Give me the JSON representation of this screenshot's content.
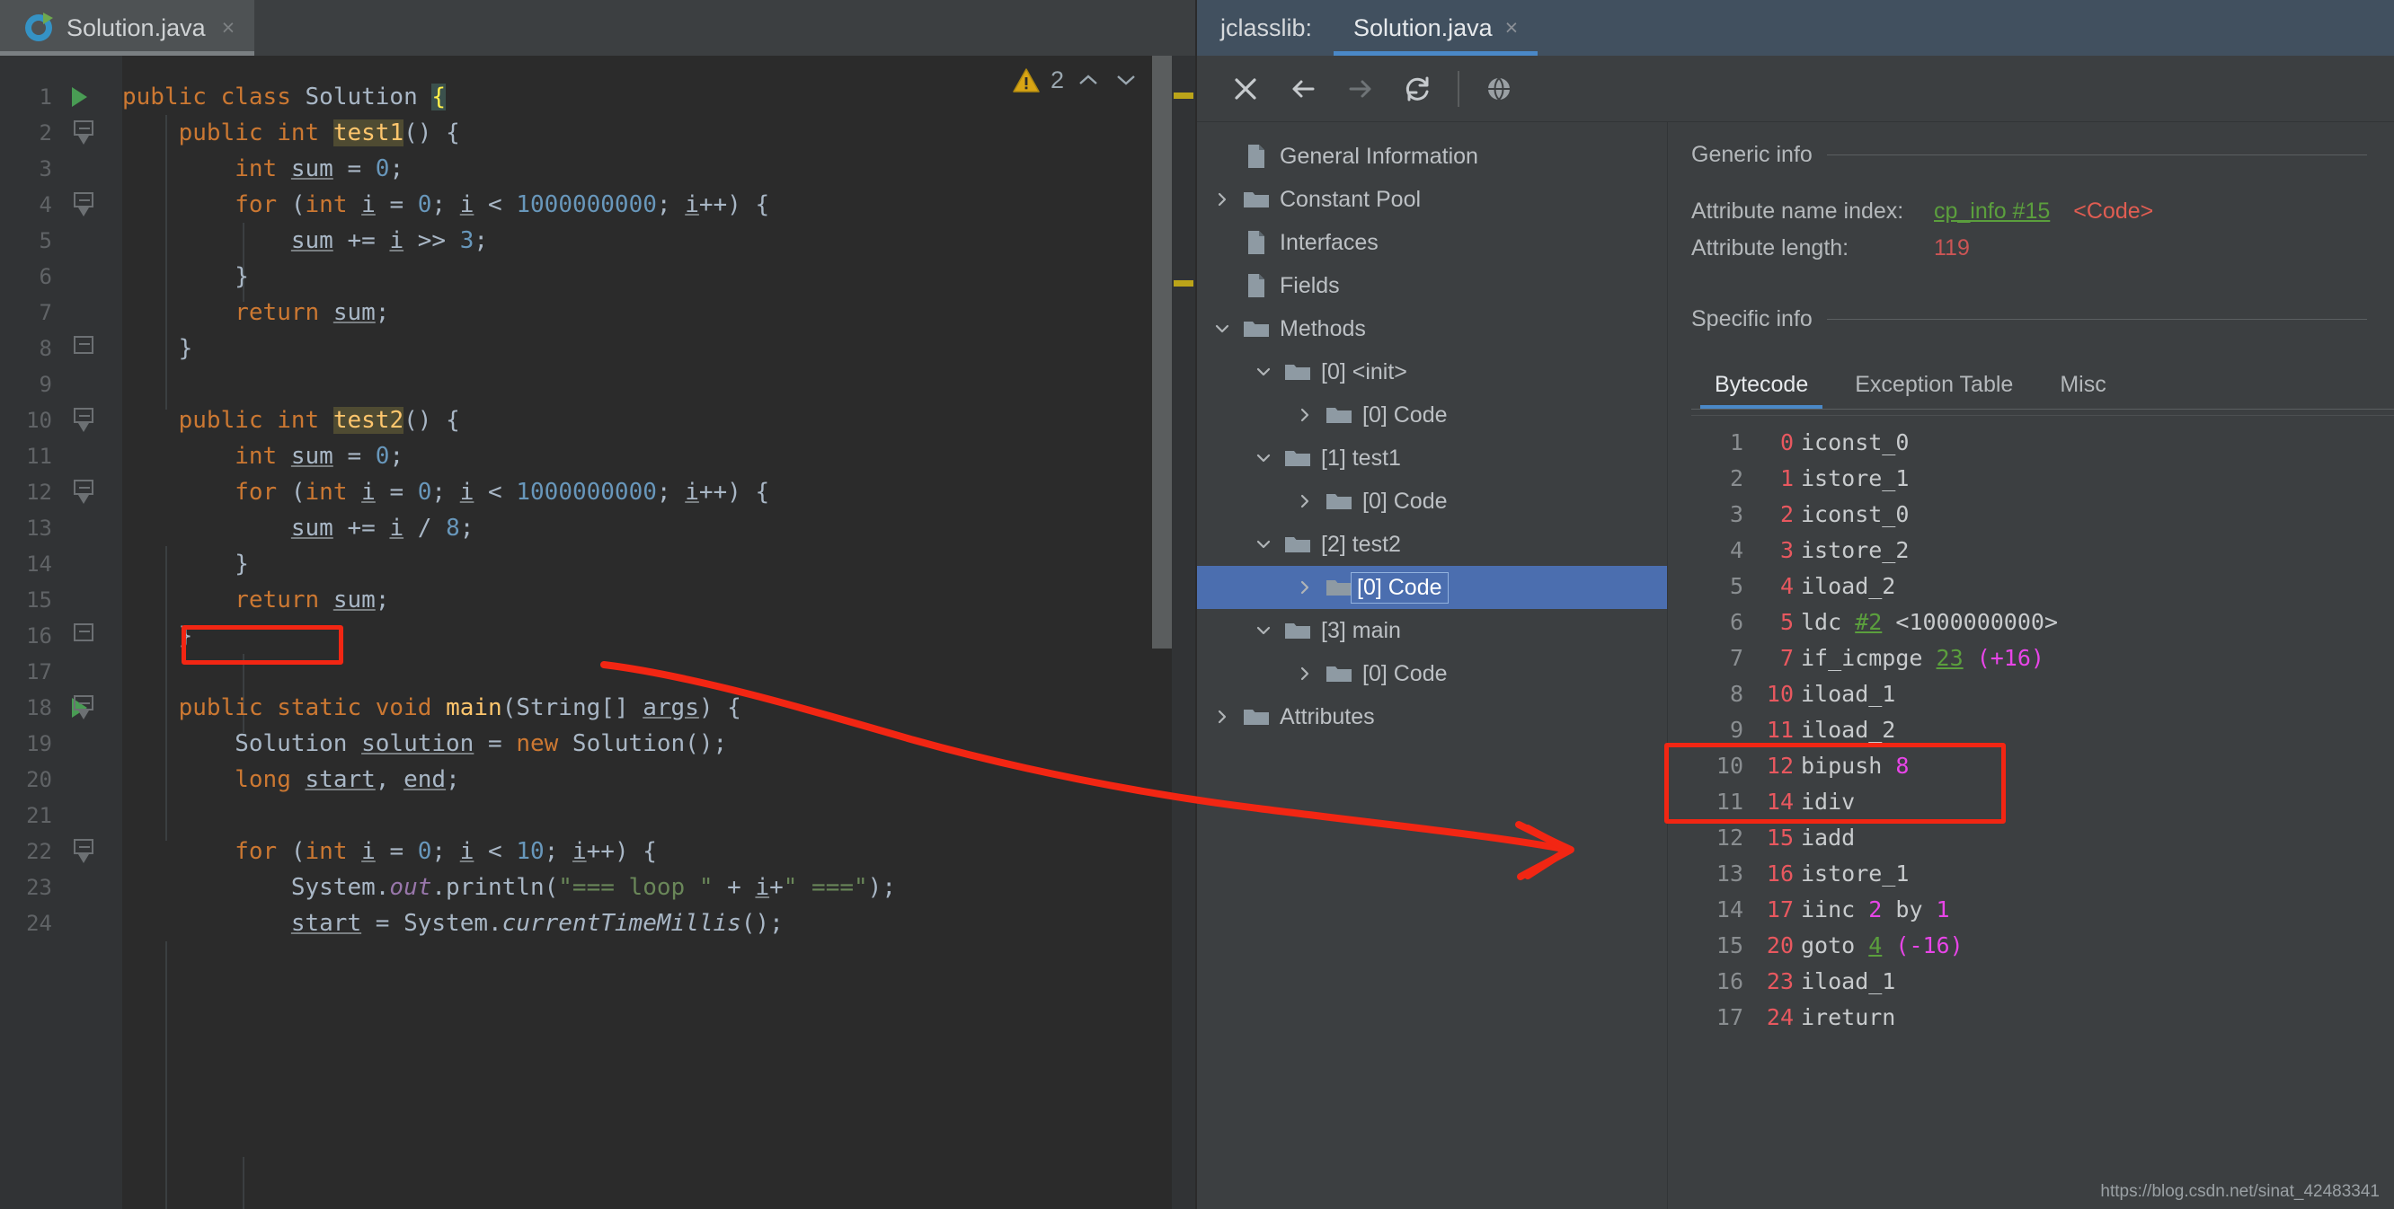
{
  "editor": {
    "tab": {
      "label": "Solution.java",
      "close": "×",
      "icon": "java-class-icon"
    },
    "inspection": {
      "warning_count": "2",
      "up": "⌃",
      "down": "⌄"
    },
    "lines": [
      {
        "n": "1",
        "mark": "run",
        "fold": "",
        "text": "public class Solution {"
      },
      {
        "n": "2",
        "mark": "",
        "fold": "start",
        "text": "    public int test1() {"
      },
      {
        "n": "3",
        "mark": "",
        "fold": "",
        "text": "        int sum = 0;"
      },
      {
        "n": "4",
        "mark": "",
        "fold": "start",
        "text": "        for (int i = 0; i < 1000000000; i++) {"
      },
      {
        "n": "5",
        "mark": "",
        "fold": "",
        "text": "            sum += i >> 3;"
      },
      {
        "n": "6",
        "mark": "",
        "fold": "",
        "text": "        }"
      },
      {
        "n": "7",
        "mark": "",
        "fold": "",
        "text": "        return sum;"
      },
      {
        "n": "8",
        "mark": "",
        "fold": "end",
        "text": "    }"
      },
      {
        "n": "9",
        "mark": "",
        "fold": "",
        "text": ""
      },
      {
        "n": "10",
        "mark": "",
        "fold": "start",
        "text": "    public int test2() {"
      },
      {
        "n": "11",
        "mark": "",
        "fold": "",
        "text": "        int sum = 0;"
      },
      {
        "n": "12",
        "mark": "",
        "fold": "start",
        "text": "        for (int i = 0; i < 1000000000; i++) {"
      },
      {
        "n": "13",
        "mark": "",
        "fold": "",
        "text": "            sum += i / 8;"
      },
      {
        "n": "14",
        "mark": "",
        "fold": "",
        "text": "        }"
      },
      {
        "n": "15",
        "mark": "",
        "fold": "",
        "text": "        return sum;"
      },
      {
        "n": "16",
        "mark": "",
        "fold": "end",
        "text": "    }"
      },
      {
        "n": "17",
        "mark": "",
        "fold": "",
        "text": ""
      },
      {
        "n": "18",
        "mark": "run",
        "fold": "start",
        "text": "    public static void main(String[] args) {"
      },
      {
        "n": "19",
        "mark": "",
        "fold": "",
        "text": "        Solution solution = new Solution();"
      },
      {
        "n": "20",
        "mark": "",
        "fold": "",
        "text": "        long start, end;"
      },
      {
        "n": "21",
        "mark": "",
        "fold": "",
        "text": ""
      },
      {
        "n": "22",
        "mark": "",
        "fold": "start",
        "text": "        for (int i = 0; i < 10; i++) {"
      },
      {
        "n": "23",
        "mark": "",
        "fold": "",
        "text": "            System.out.println(\"=== loop \" + i+\" ===\");"
      },
      {
        "n": "24",
        "mark": "",
        "fold": "",
        "text": "            start = System.currentTimeMillis();"
      }
    ]
  },
  "annotations": {
    "code_box_label": "sum += i / 8;",
    "bytecode_box_label": "12 bipush 8 / 14 idiv",
    "arrow_color": "#f22613"
  },
  "tool": {
    "title": "jclasslib:",
    "tab": {
      "label": "Solution.java",
      "close": "×"
    },
    "toolbar": [
      {
        "name": "close-icon",
        "label": "Close"
      },
      {
        "name": "back-icon",
        "label": "Back"
      },
      {
        "name": "forward-icon",
        "label": "Forward"
      },
      {
        "name": "reload-icon",
        "label": "Reload"
      },
      {
        "name": "browse-icon",
        "label": "Browse"
      }
    ],
    "tree": [
      {
        "label": "General Information",
        "indent": 1,
        "twist": "none",
        "icon": "file-icon",
        "selected": false
      },
      {
        "label": "Constant Pool",
        "indent": 1,
        "twist": "right",
        "icon": "folder-icon",
        "selected": false
      },
      {
        "label": "Interfaces",
        "indent": 1,
        "twist": "none",
        "icon": "file-icon",
        "selected": false
      },
      {
        "label": "Fields",
        "indent": 1,
        "twist": "none",
        "icon": "file-icon",
        "selected": false
      },
      {
        "label": "Methods",
        "indent": 1,
        "twist": "down",
        "icon": "folder-icon",
        "selected": false
      },
      {
        "label": "[0] <init>",
        "indent": 2,
        "twist": "down",
        "icon": "folder-icon",
        "selected": false
      },
      {
        "label": "[0] Code",
        "indent": 3,
        "twist": "right",
        "icon": "folder-icon",
        "selected": false
      },
      {
        "label": "[1] test1",
        "indent": 2,
        "twist": "down",
        "icon": "folder-icon",
        "selected": false
      },
      {
        "label": "[0] Code",
        "indent": 3,
        "twist": "right",
        "icon": "folder-icon",
        "selected": false
      },
      {
        "label": "[2] test2",
        "indent": 2,
        "twist": "down",
        "icon": "folder-icon",
        "selected": false
      },
      {
        "label": "[0] Code",
        "indent": 3,
        "twist": "right",
        "icon": "folder-icon",
        "selected": true
      },
      {
        "label": "[3] main",
        "indent": 2,
        "twist": "down",
        "icon": "folder-icon",
        "selected": false
      },
      {
        "label": "[0] Code",
        "indent": 3,
        "twist": "right",
        "icon": "folder-icon",
        "selected": false
      },
      {
        "label": "Attributes",
        "indent": 1,
        "twist": "right",
        "icon": "folder-icon",
        "selected": false
      }
    ],
    "generic_info": {
      "heading": "Generic info",
      "attribute_name_index_label": "Attribute name index:",
      "attribute_name_index_link": "cp_info #15",
      "attribute_name_index_value": "<Code>",
      "attribute_length_label": "Attribute length:",
      "attribute_length_value": "119"
    },
    "specific_info": {
      "heading": "Specific info",
      "tabs": [
        {
          "label": "Bytecode",
          "active": true
        },
        {
          "label": "Exception Table",
          "active": false
        },
        {
          "label": "Misc",
          "active": false
        }
      ]
    },
    "bytecode": [
      {
        "ln": "1",
        "offset": "0",
        "mnemonic": "iconst_0",
        "operand": "",
        "extra": "",
        "highlight": false
      },
      {
        "ln": "2",
        "offset": "1",
        "mnemonic": "istore_1",
        "operand": "",
        "extra": "",
        "highlight": false
      },
      {
        "ln": "3",
        "offset": "2",
        "mnemonic": "iconst_0",
        "operand": "",
        "extra": "",
        "highlight": false
      },
      {
        "ln": "4",
        "offset": "3",
        "mnemonic": "istore_2",
        "operand": "",
        "extra": "",
        "highlight": false
      },
      {
        "ln": "5",
        "offset": "4",
        "mnemonic": "iload_2",
        "operand": "",
        "extra": "",
        "highlight": false
      },
      {
        "ln": "6",
        "offset": "5",
        "mnemonic": "ldc",
        "operand": "#2",
        "extra": "<1000000000>",
        "highlight": false
      },
      {
        "ln": "7",
        "offset": "7",
        "mnemonic": "if_icmpge",
        "operand": "23",
        "extra": "(+16)",
        "highlight": false
      },
      {
        "ln": "8",
        "offset": "10",
        "mnemonic": "iload_1",
        "operand": "",
        "extra": "",
        "highlight": false
      },
      {
        "ln": "9",
        "offset": "11",
        "mnemonic": "iload_2",
        "operand": "",
        "extra": "",
        "highlight": false
      },
      {
        "ln": "10",
        "offset": "12",
        "mnemonic": "bipush",
        "operand": "8",
        "extra": "",
        "highlight": true
      },
      {
        "ln": "11",
        "offset": "14",
        "mnemonic": "idiv",
        "operand": "",
        "extra": "",
        "highlight": true
      },
      {
        "ln": "12",
        "offset": "15",
        "mnemonic": "iadd",
        "operand": "",
        "extra": "",
        "highlight": false
      },
      {
        "ln": "13",
        "offset": "16",
        "mnemonic": "istore_1",
        "operand": "",
        "extra": "",
        "highlight": false
      },
      {
        "ln": "14",
        "offset": "17",
        "mnemonic": "iinc",
        "operand": "2",
        "extra": "by 1",
        "highlight": false
      },
      {
        "ln": "15",
        "offset": "20",
        "mnemonic": "goto",
        "operand": "4",
        "extra": "(-16)",
        "highlight": false
      },
      {
        "ln": "16",
        "offset": "23",
        "mnemonic": "iload_1",
        "operand": "",
        "extra": "",
        "highlight": false
      },
      {
        "ln": "17",
        "offset": "24",
        "mnemonic": "ireturn",
        "operand": "",
        "extra": "",
        "highlight": false
      }
    ]
  },
  "watermark": "https://blog.csdn.net/sinat_42483341",
  "colors": {
    "accent_blue": "#4a88c7",
    "selection_blue": "#4b6eaf",
    "annotation_red": "#f22613",
    "warning_yellow": "#bba419",
    "keyword_orange": "#cc7832",
    "number_blue": "#6897bb",
    "string_green": "#6a8759",
    "method_yellow": "#ffc66d",
    "cp_link_green": "#5b9f3d",
    "offset_red": "#e8585f",
    "immediate_magenta": "#e845e8"
  }
}
